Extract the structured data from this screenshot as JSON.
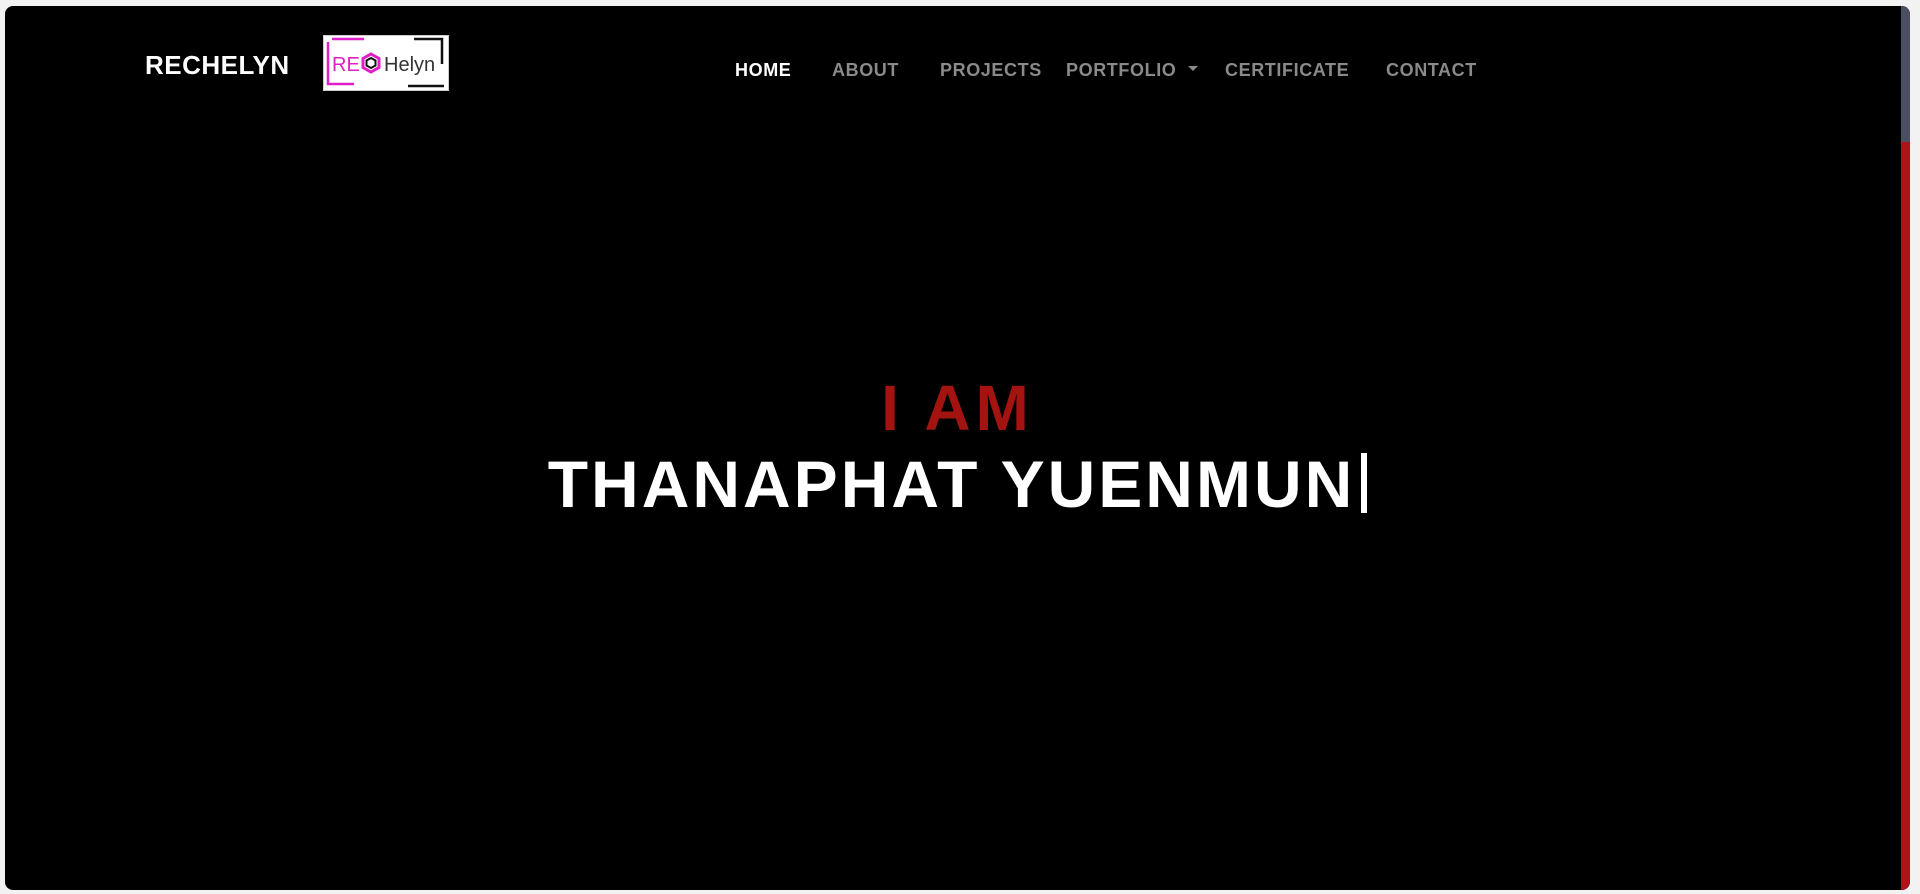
{
  "header": {
    "brand": "RECHELYN",
    "logo_text": "REHelyn"
  },
  "nav": {
    "items": [
      {
        "label": "HOME",
        "active": true
      },
      {
        "label": "ABOUT",
        "active": false
      },
      {
        "label": "PROJECTS",
        "active": false
      },
      {
        "label": "PORTFOLIO",
        "active": false,
        "dropdown": true
      },
      {
        "label": "CERTIFICATE",
        "active": false
      },
      {
        "label": "CONTACT",
        "active": false
      }
    ]
  },
  "hero": {
    "kicker": "I AM",
    "name": "THANAPHAT YUENMUN"
  },
  "colors": {
    "background": "#000000",
    "accent": "#a3130f",
    "nav_inactive": "#8a8a8a",
    "nav_active": "#ffffff",
    "logo_pink": "#e01fc8"
  },
  "icons": {
    "caret": "chevron-down-icon",
    "logo_mark": "hexagon-icon"
  }
}
